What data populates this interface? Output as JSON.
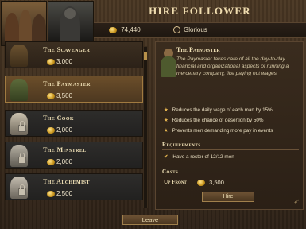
{
  "window": {
    "title": "Hire Follower"
  },
  "header": {
    "money": "74,440",
    "status": "Glorious"
  },
  "followers": [
    {
      "name": "The Scavenger",
      "price": "3,000",
      "state": "available"
    },
    {
      "name": "The Paymaster",
      "price": "3,500",
      "state": "selected"
    },
    {
      "name": "The Cook",
      "price": "2,000",
      "state": "locked"
    },
    {
      "name": "The Minstrel",
      "price": "2,000",
      "state": "locked"
    },
    {
      "name": "The Alchemist",
      "price": "2,500",
      "state": "locked"
    }
  ],
  "detail": {
    "name": "The Paymaster",
    "description": "The Paymaster takes care of all the day-to-day financial and organizational aspects of running a mercenary company, like paying out wages.",
    "effects": [
      "Reduces the daily wage of each man by 15%",
      "Reduces the chance of desertion by 50%",
      "Prevents men demanding more pay in events"
    ],
    "requirements_title": "Requirements",
    "requirement": "Have a roster of 12/12 men",
    "costs_title": "Costs",
    "upfront_label": "Up Front",
    "upfront_cost": "3,500",
    "hire_label": "Hire"
  },
  "footer": {
    "leave_label": "Leave"
  },
  "colors": {
    "accent": "#e5b550",
    "panel": "#3a2c1e",
    "selected": "#6b4e2a"
  },
  "icons": [
    "coin-icon",
    "glorious-icon",
    "star-icon",
    "check-icon",
    "lock-icon",
    "arrow-icon"
  ]
}
